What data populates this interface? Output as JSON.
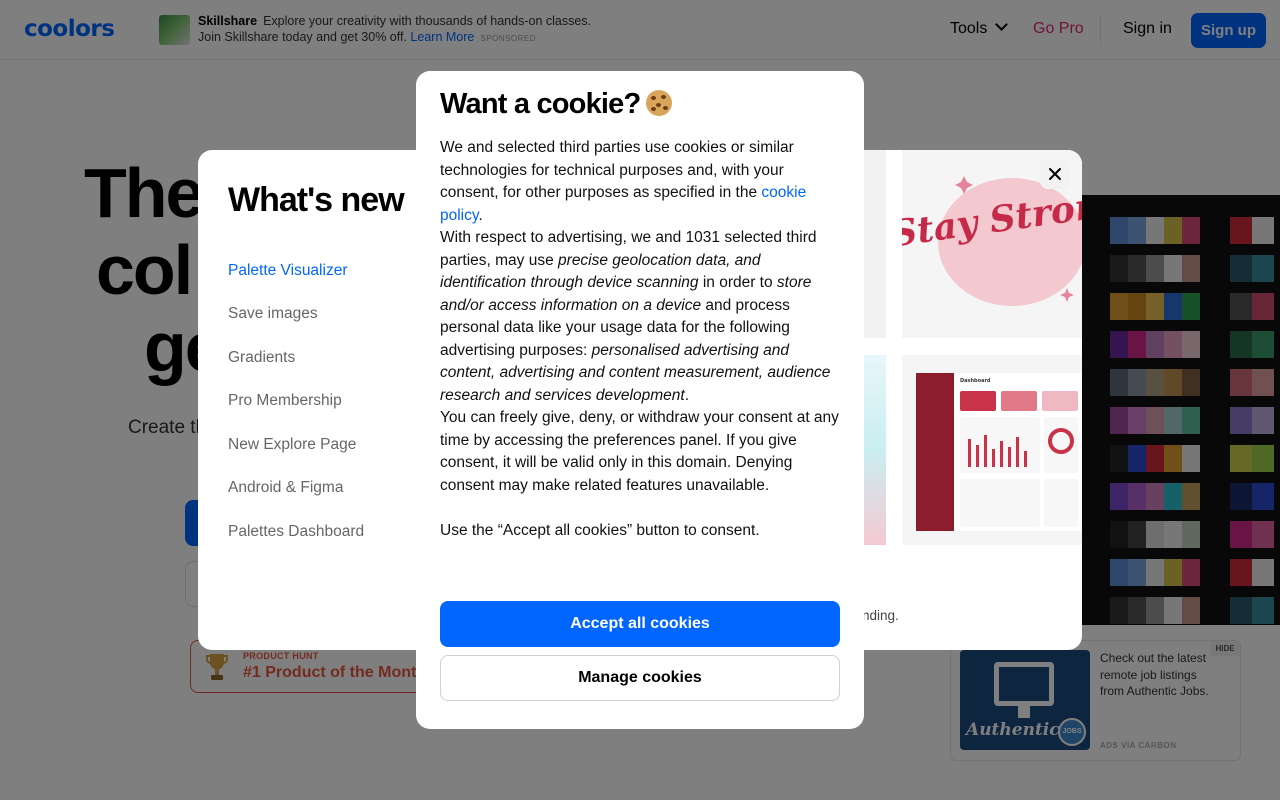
{
  "nav": {
    "logo": "coolors",
    "ad": {
      "brand": "Skillshare",
      "text": "Explore your creativity with thousands of hands-on classes. Join Skillshare today and get 30% off.",
      "link": "Learn More",
      "sponsored": "SPONSORED"
    },
    "tools": "Tools",
    "go_pro": "Go Pro",
    "sign_in": "Sign in",
    "sign_up": "Sign up"
  },
  "hero": {
    "title_lines": [
      "The",
      "col",
      "ge"
    ],
    "subtitle": "Create th thous"
  },
  "product_hunt": {
    "label": "PRODUCT HUNT",
    "title": "#1 Product of the Mont"
  },
  "side_ad": {
    "text": "Check out the latest remote job listings from Authentic Jobs.",
    "hide": "HIDE",
    "via": "ADS VIA CARBON",
    "logo_word": "Authentic",
    "logo_badge": "JOBS"
  },
  "whats_new": {
    "title": "What's new",
    "items": [
      {
        "label": "Palette Visualizer",
        "active": true
      },
      {
        "label": "Save images",
        "active": false
      },
      {
        "label": "Gradients",
        "active": false
      },
      {
        "label": "Pro Membership",
        "active": false
      },
      {
        "label": "New Explore Page",
        "active": false
      },
      {
        "label": "Android & Figma",
        "active": false
      },
      {
        "label": "Palettes Dashboard",
        "active": false
      }
    ],
    "caption": "nding.",
    "thumb1_text": "Stay Strong",
    "thumb2_title": "Dashboard",
    "colors": {
      "accent": "#0066ff",
      "muted": "#666666"
    }
  },
  "cookie": {
    "title": "Want a cookie?",
    "body": {
      "p1_text": "We and selected third parties use cookies or similar technologies for technical purposes and, with your consent, for other purposes as specified in the ",
      "p1_link": "cookie policy",
      "p1_end": ".",
      "p2_a": "With respect to advertising, we and 1031 selected third parties, may use ",
      "p2_b": "precise geolocation data, and identification through device scanning",
      "p2_c": " in order to ",
      "p2_d": "store and/or access information on a device",
      "p2_e": " and process personal data like your usage data for the following advertising purposes: ",
      "p2_f": "personalised advertising and content, advertising and content measurement, audience research and services development",
      "p2_g": ".",
      "p3": "You can freely give, deny, or withdraw your consent at any time by accessing the preferences panel. If you give consent, it will be valid only in this domain. Denying consent may make related features unavailable.",
      "p4": "Use the “Accept all cookies” button to consent."
    },
    "accept": "Accept all cookies",
    "manage": "Manage cookies",
    "colors": {
      "primary": "#0066ff"
    }
  }
}
